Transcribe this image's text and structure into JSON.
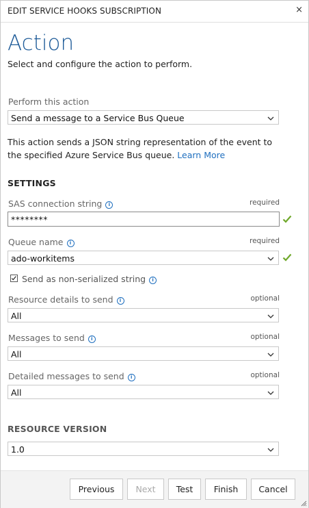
{
  "dialog": {
    "title": "EDIT SERVICE HOOKS SUBSCRIPTION",
    "close_symbol": "×"
  },
  "header": {
    "heading": "Action",
    "subheading": "Select and configure the action to perform."
  },
  "action": {
    "label": "Perform this action",
    "selected": "Send a message to a Service Bus Queue",
    "description": "This action sends a JSON string representation of the event to the specified Azure Service Bus queue.",
    "learn_more": "Learn More"
  },
  "settings": {
    "title": "SETTINGS",
    "sas": {
      "label": "SAS connection string",
      "tag": "required",
      "value": "********"
    },
    "queue": {
      "label": "Queue name",
      "tag": "required",
      "value": "ado-workitems"
    },
    "non_serialized": {
      "label": "Send as non-serialized string",
      "checked": true
    },
    "resource_details": {
      "label": "Resource details to send",
      "tag": "optional",
      "value": "All"
    },
    "messages": {
      "label": "Messages to send",
      "tag": "optional",
      "value": "All"
    },
    "detailed_messages": {
      "label": "Detailed messages to send",
      "tag": "optional",
      "value": "All"
    }
  },
  "resource_version": {
    "title": "RESOURCE VERSION",
    "value": "1.0"
  },
  "footer": {
    "previous": "Previous",
    "next": "Next",
    "test": "Test",
    "finish": "Finish",
    "cancel": "Cancel"
  },
  "colors": {
    "heading": "#1f5c99",
    "link": "#1f6fbf",
    "valid_check": "#6fa82a"
  },
  "icons": [
    "close-icon",
    "info-icon",
    "chevron-down-icon",
    "checkmark-icon",
    "checkbox-icon",
    "resize-grip-icon"
  ]
}
